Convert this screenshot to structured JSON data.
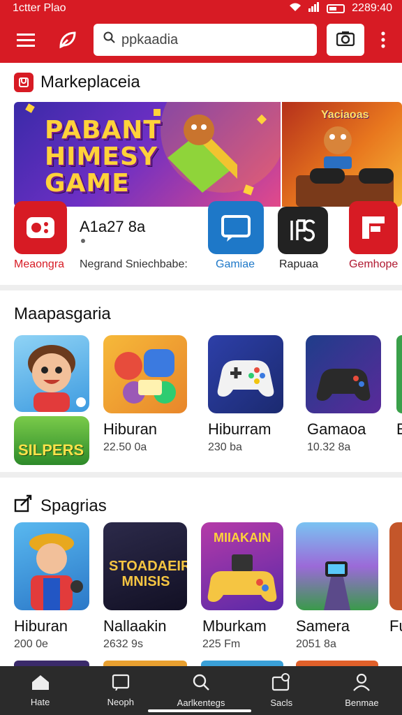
{
  "status": {
    "left_text": "1ctter Plao",
    "time": "2289:40"
  },
  "appbar": {
    "menu_icon": "hamburger-icon",
    "logo_icon": "leaf-logo-icon",
    "search_placeholder": "ppkaadia",
    "camera_icon": "camera-icon",
    "more_icon": "more-vertical-icon"
  },
  "marketplace": {
    "title": "Markeplaceia",
    "banner": {
      "title": "PABANT HIMESY GAME",
      "side_title": "Yaciaoas"
    },
    "featured_app": {
      "name": "A1a27 8a",
      "meta": "Negrand Sniechbabe:"
    },
    "icons": [
      {
        "label": "Meaongra",
        "color": "#d71b24"
      },
      {
        "label": "Gamiae",
        "color": "#1e78c8"
      },
      {
        "label": "Rapuaa",
        "color": "#222222"
      },
      {
        "label": "Gemhope",
        "color": "#b01830"
      }
    ]
  },
  "recommended": {
    "title": "Maapasgaria",
    "apps": [
      {
        "title": "SILPERS",
        "sub": ""
      },
      {
        "title": "Hiburan",
        "sub": "22.50 0a"
      },
      {
        "title": "Hiburram",
        "sub": "230 ba"
      },
      {
        "title": "Gamaoa",
        "sub": "10.32 8a"
      },
      {
        "title": "E",
        "sub": ""
      }
    ]
  },
  "sports": {
    "title": "Spagrias",
    "apps": [
      {
        "title": "Hiburan",
        "sub": "200 0e"
      },
      {
        "title": "Nallaakin",
        "sub": "2632 9s"
      },
      {
        "title": "Mburkam",
        "sub": "225 Fm"
      },
      {
        "title": "Samera",
        "sub": "2051 8a"
      },
      {
        "title": "Fu",
        "sub": ""
      }
    ],
    "tile_texts": {
      "t2": "STOADAEIR MNISIS",
      "t3": "MIIAKAIN"
    }
  },
  "bottomnav": [
    {
      "label": "Hate",
      "icon": "home-icon"
    },
    {
      "label": "Neoph",
      "icon": "tablet-icon"
    },
    {
      "label": "Aarlkentegs",
      "icon": "search-icon"
    },
    {
      "label": "Sacls",
      "icon": "profile-card-icon"
    },
    {
      "label": "Benmae",
      "icon": "person-icon"
    }
  ],
  "colors": {
    "brand": "#d71b24",
    "nav_bg": "#2b2b2b"
  }
}
